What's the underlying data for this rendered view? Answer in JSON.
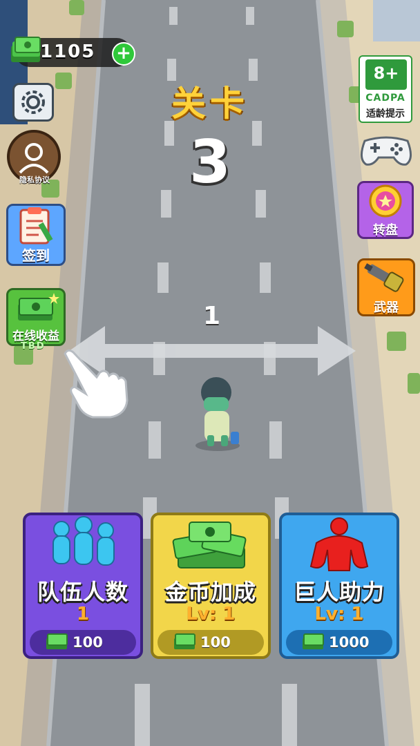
{
  "hud": {
    "cash": "1105",
    "cash_plus": "+"
  },
  "level": {
    "title": "关卡",
    "number": "3"
  },
  "left_buttons": {
    "privacy": "隐私协议",
    "signin": "签到",
    "online": "在线收益",
    "online_timer": "TBD"
  },
  "right_buttons": {
    "cadpa_top": "CADPA",
    "cadpa_age": "8+",
    "cadpa_label": "适龄提示",
    "wheel": "转盘",
    "weapon": "武器"
  },
  "swipe": {
    "count": "1"
  },
  "cards": [
    {
      "title": "队伍人数",
      "level": "1",
      "price": "100"
    },
    {
      "title": "金币加成",
      "level": "Lv: 1",
      "price": "100"
    },
    {
      "title": "巨人助力",
      "level": "Lv: 1",
      "price": "1000"
    }
  ],
  "colors": {
    "road": "#8e9398",
    "lane_mark": "#c7cacd",
    "level_title": "#ffd23a",
    "card_team": "#7a4fe0",
    "card_coin": "#f2d64a",
    "card_giant": "#3fa7ef",
    "cash_green": "#2fc83a"
  }
}
